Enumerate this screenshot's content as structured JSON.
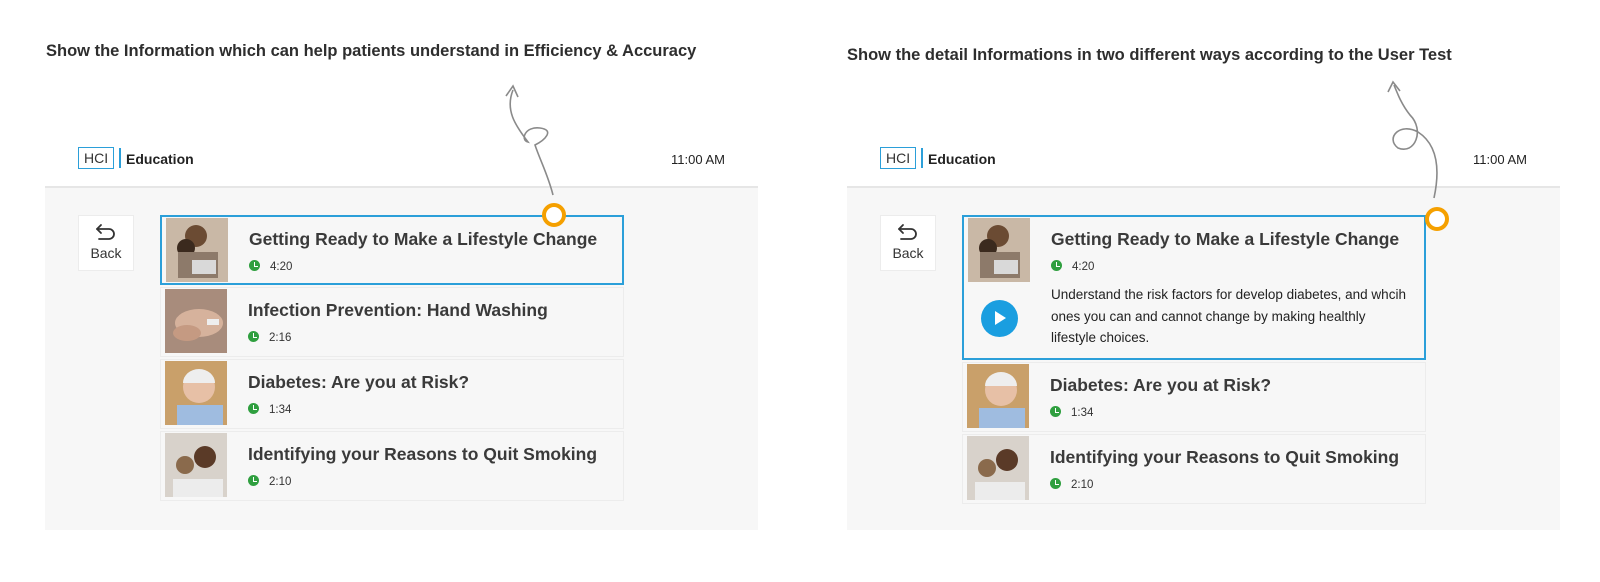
{
  "captions": {
    "left": "Show the Information which can help patients understand in Efficiency & Accuracy",
    "right": "Show the detail Informations in two different ways according to the User Test"
  },
  "app": {
    "logo": "HCI",
    "title": "Education",
    "time": "11:00 AM",
    "back_label": "Back"
  },
  "left_list": [
    {
      "title": "Getting Ready to Make a Lifestyle Change",
      "duration": "4:20",
      "selected": true,
      "thumb": "couple-laptop"
    },
    {
      "title": "Infection Prevention: Hand Washing",
      "duration": "2:16",
      "selected": false,
      "thumb": "hands"
    },
    {
      "title": "Diabetes: Are you at Risk?",
      "duration": "1:34",
      "selected": false,
      "thumb": "elderly-man"
    },
    {
      "title": "Identifying your Reasons to Quit Smoking",
      "duration": "2:10",
      "selected": false,
      "thumb": "child-teddy"
    }
  ],
  "right_list": [
    {
      "title": "Getting Ready to Make a Lifestyle Change",
      "duration": "4:20",
      "selected": true,
      "thumb": "couple-laptop",
      "description": "Understand the risk factors for develop diabetes, and whcih ones you can and cannot change by making healthly lifestyle choices."
    },
    {
      "title": "Diabetes: Are you at Risk?",
      "duration": "1:34",
      "selected": false,
      "thumb": "elderly-man"
    },
    {
      "title": "Identifying your Reasons to Quit Smoking",
      "duration": "2:10",
      "selected": false,
      "thumb": "child-teddy"
    }
  ],
  "colors": {
    "accent": "#2b9fd9",
    "hotspot": "#f5a000",
    "clock_icon": "#2f9f3f",
    "play": "#1a9ee0"
  },
  "icons": [
    "back-arrow-icon",
    "clock-icon",
    "play-icon",
    "hotspot-marker-icon"
  ]
}
